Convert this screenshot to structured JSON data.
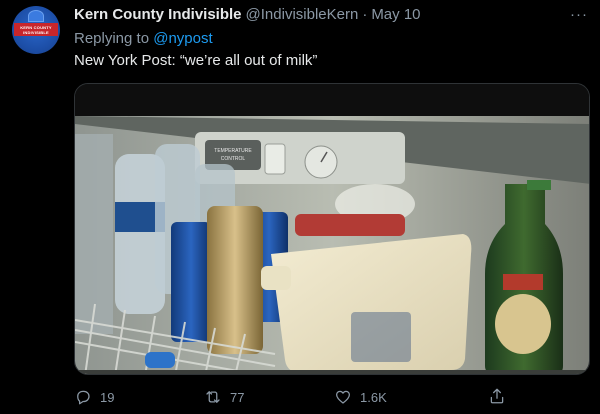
{
  "tweet": {
    "display_name": "Kern County Indivisible",
    "handle": "@IndivisibleKern",
    "separator": "·",
    "date": "May 10",
    "replying_prefix": "Replying to ",
    "replying_to": "@nypost",
    "text": "New York Post: “we’re all out of milk”",
    "avatar_text_line1": "KERN COUNTY",
    "avatar_text_line2": "INDIVISIBLE",
    "more_label": "···"
  },
  "media": {
    "thermostat_text_line1": "TEMPERATURE",
    "thermostat_text_line2": "CONTROL"
  },
  "actions": {
    "replies": "19",
    "retweets": "77",
    "likes": "1.6K"
  },
  "colors": {
    "background": "#000000",
    "link": "#1d9bf0",
    "secondary_text": "#8b98a5"
  }
}
